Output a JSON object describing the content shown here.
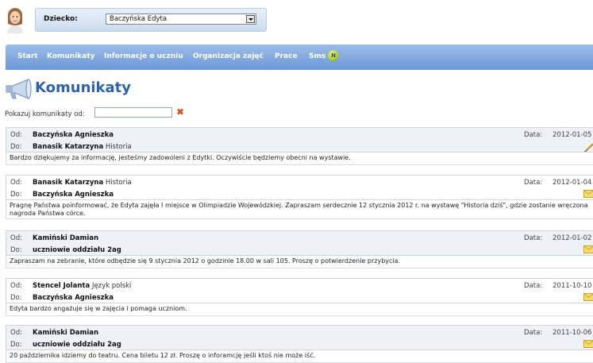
{
  "child_selector": {
    "label": "Dziecko:",
    "value": "Baczyńska Edyta"
  },
  "nav": {
    "items": [
      "Start",
      "Komunikaty",
      "Informacje o uczniu",
      "Organizacja zajęć",
      "Prace",
      "Sms"
    ],
    "sms_badge": "N"
  },
  "page": {
    "title": "Komunikaty",
    "filter_label": "Pokazuj komunikaty od:",
    "filter_value": ""
  },
  "labels": {
    "from": "Od:",
    "to": "Do:",
    "date": "Data:"
  },
  "messages": [
    {
      "from_name": "Baczyńska Agnieszka",
      "from_subject": "",
      "to_name": "Banasik Katarzyna",
      "to_subject": "Historia",
      "date": "2012-01-05",
      "icon": "pencil-icon",
      "body": "Bardzo dziękujemy za informację, jesteśmy zadowoleni z Edytki. Oczywiście będziemy obecni na wystawie."
    },
    {
      "from_name": "Banasik Katarzyna",
      "from_subject": "Historia",
      "to_name": "Baczyńska Agnieszka",
      "to_subject": "",
      "date": "2012-01-04",
      "icon": "envelope-icon",
      "body": "Pragnę Państwa poinformować, że Edyta zajęła I miejsce w Olimpiadzie Wojewódzkiej. Zapraszam serdecznie 12 stycznia 2012 r. na wystawę \"Historia dziś\", gdzie zostanie wręczona nagroda Państwa córce."
    },
    {
      "from_name": "Kamiński Damian",
      "from_subject": "",
      "to_name": "uczniowie oddziału 2ag",
      "to_subject": "",
      "date": "2012-01-02",
      "icon": "envelope-icon",
      "body": "Zapraszam na zebranie, które odbędzie się 9 stycznia 2012 o godzinie 18.00 w sali 105. Proszę o potwierdzenie przybycia."
    },
    {
      "from_name": "Stencel Jolanta",
      "from_subject": "Język polski",
      "to_name": "Baczyńska Agnieszka",
      "to_subject": "",
      "date": "2011-10-10",
      "icon": "envelope-icon",
      "body": "Edyta bardzo angażuje się w zajęcia i pomaga uczniom."
    },
    {
      "from_name": "Kamiński Damian",
      "from_subject": "",
      "to_name": "uczniowie oddziału 2ag",
      "to_subject": "",
      "date": "2011-10-06",
      "icon": "envelope-icon",
      "body": "20 października idziemy do teatru. Cena biletu 12 zł. Proszę o inforamcję jeśli ktoś nie może iść."
    }
  ]
}
